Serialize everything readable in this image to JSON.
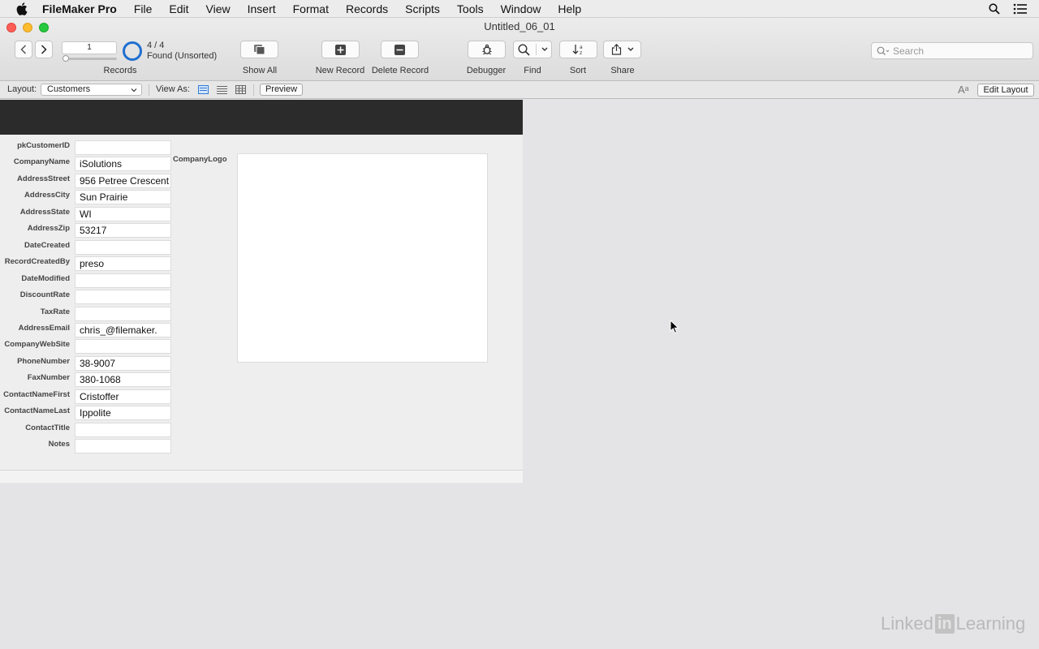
{
  "menubar": {
    "app_name": "FileMaker Pro",
    "items": [
      "File",
      "Edit",
      "View",
      "Insert",
      "Format",
      "Records",
      "Scripts",
      "Tools",
      "Window",
      "Help"
    ]
  },
  "window": {
    "title": "Untitled_06_01"
  },
  "toolbar": {
    "record_number": "1",
    "found_count": "4 / 4",
    "found_status": "Found (Unsorted)",
    "records_label": "Records",
    "show_all_label": "Show All",
    "new_record_label": "New Record",
    "delete_record_label": "Delete Record",
    "debugger_label": "Debugger",
    "find_label": "Find",
    "sort_label": "Sort",
    "share_label": "Share",
    "search_placeholder": "Search"
  },
  "layoutbar": {
    "layout_label": "Layout:",
    "layout_value": "Customers",
    "view_as_label": "View As:",
    "preview_label": "Preview",
    "edit_layout_label": "Edit Layout",
    "aa_label": "Aᵃ"
  },
  "record": {
    "fields": [
      {
        "label": "pkCustomerID",
        "value": ""
      },
      {
        "label": "CompanyName",
        "value": "iSolutions"
      },
      {
        "label": "AddressStreet",
        "value": "956 Petree Crescent"
      },
      {
        "label": "AddressCity",
        "value": "Sun Prairie"
      },
      {
        "label": "AddressState",
        "value": "WI"
      },
      {
        "label": "AddressZip",
        "value": "53217"
      },
      {
        "label": "DateCreated",
        "value": ""
      },
      {
        "label": "RecordCreatedBy",
        "value": "preso"
      },
      {
        "label": "DateModified",
        "value": ""
      },
      {
        "label": "DiscountRate",
        "value": ""
      },
      {
        "label": "TaxRate",
        "value": ""
      },
      {
        "label": "AddressEmail",
        "value": "chris_@filemaker."
      },
      {
        "label": "CompanyWebSite",
        "value": ""
      },
      {
        "label": "PhoneNumber",
        "value": "38-9007"
      },
      {
        "label": "FaxNumber",
        "value": "380-1068"
      },
      {
        "label": "ContactNameFirst",
        "value": "Cristoffer"
      },
      {
        "label": "ContactNameLast",
        "value": "Ippolite"
      },
      {
        "label": "ContactTitle",
        "value": ""
      },
      {
        "label": "Notes",
        "value": ""
      }
    ],
    "logo_label": "CompanyLogo"
  },
  "watermark": {
    "left": "Linked",
    "box": "in",
    "right": "Learning"
  },
  "colors": {
    "accent": "#1f6fd0",
    "header_band": "#2b2b2b"
  }
}
